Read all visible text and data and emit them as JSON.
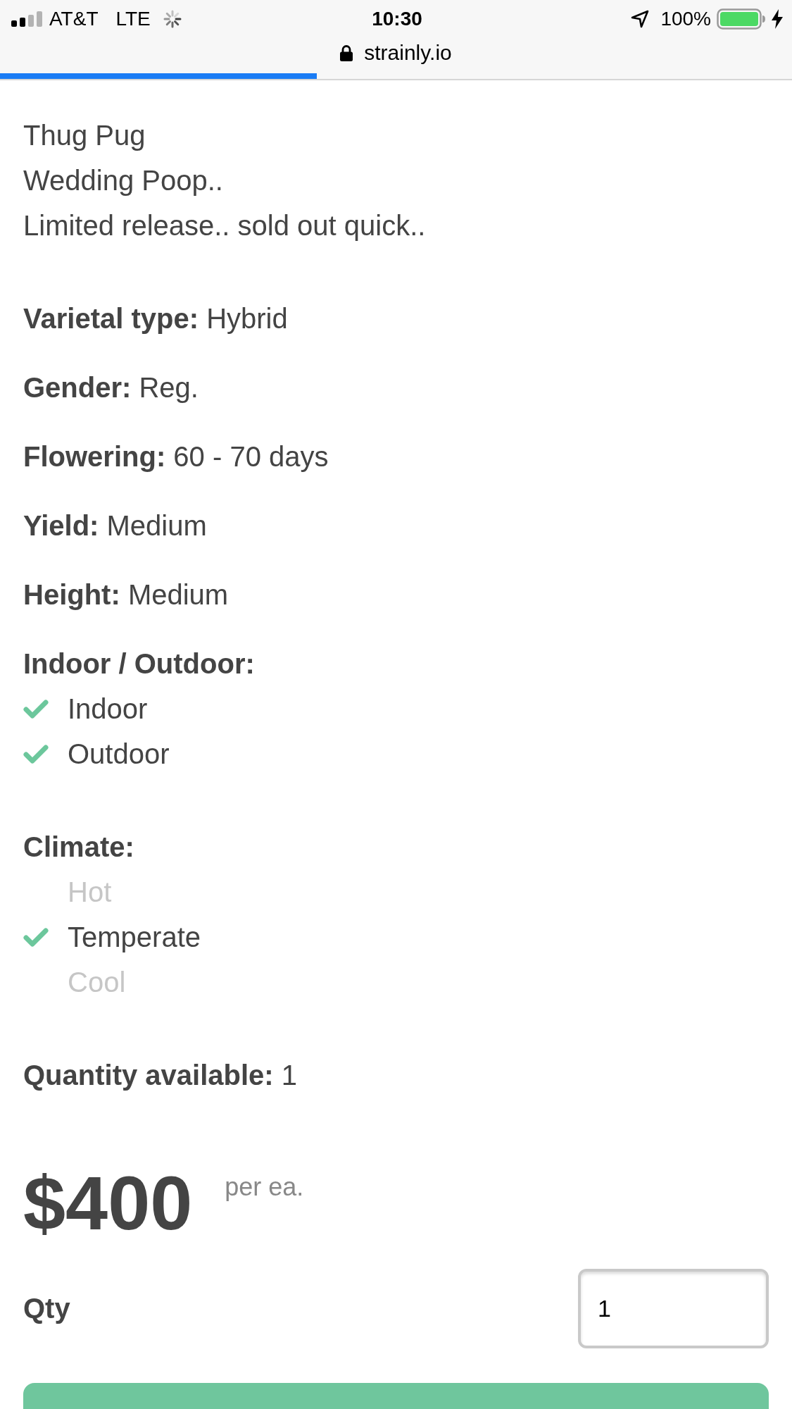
{
  "status_bar": {
    "carrier": "AT&T",
    "network": "LTE",
    "time": "10:30",
    "battery": "100%"
  },
  "address_bar": {
    "url": "strainly.io",
    "progress": {
      "level": 0.4
    }
  },
  "description": [
    "Thug Pug",
    "Wedding Poop..",
    "Limited release.. sold out quick.."
  ],
  "details": [
    {
      "kind": "field",
      "label": "Varietal type:",
      "value": "Hybrid"
    },
    {
      "kind": "field",
      "label": "Gender:",
      "value": "Reg."
    },
    {
      "kind": "field",
      "label": "Flowering:",
      "value": "60 - 70 days"
    },
    {
      "kind": "field",
      "label": "Yield:",
      "value": "Medium"
    },
    {
      "kind": "field",
      "label": "Height:",
      "value": "Medium"
    },
    {
      "kind": "checklist",
      "label": "Indoor / Outdoor:",
      "options": [
        {
          "label": "Indoor",
          "checked": true
        },
        {
          "label": "Outdoor",
          "checked": true
        }
      ]
    },
    {
      "kind": "checklist",
      "label": "Climate:",
      "options": [
        {
          "label": "Hot",
          "checked": false
        },
        {
          "label": "Temperate",
          "checked": true
        },
        {
          "label": "Cool",
          "checked": false
        }
      ]
    },
    {
      "kind": "field",
      "label": "Quantity available:",
      "value": "1"
    }
  ],
  "price": {
    "amount": "$400",
    "unit": "per ea."
  },
  "quantity": {
    "label": "Qty",
    "value": "1"
  },
  "footer_button": {
    "kind": "primary"
  }
}
